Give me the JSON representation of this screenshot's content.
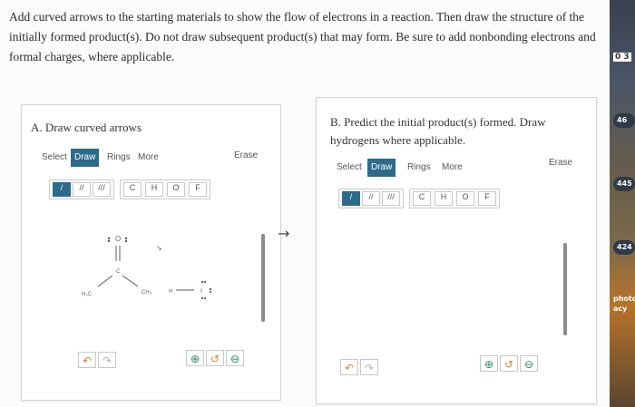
{
  "question": "Add curved arrows to the starting materials to show the flow of electrons in a reaction. Then draw the structure of the initially formed product(s). Do not draw subsequent product(s) that may form. Be sure to add nonbonding electrons and formal charges, where applicable.",
  "panel_a": {
    "title": "A. Draw curved arrows",
    "toolbar": [
      "Select",
      "Draw",
      "Rings",
      "More"
    ],
    "active_tool": "Draw",
    "erase": "Erase",
    "atoms": [
      "C",
      "H",
      "O",
      "F"
    ],
    "molecule": {
      "o_label": "O",
      "c_label": "C",
      "left_group": "H₃C",
      "right_group": "CH₃",
      "h_label": "H",
      "i_label": "I"
    }
  },
  "panel_b": {
    "title": "B. Predict the initial product(s) formed. Draw hydrogens where applicable.",
    "toolbar": [
      "Select",
      "Draw",
      "Rings",
      "More"
    ],
    "active_tool": "Draw",
    "erase": "Erase",
    "atoms": [
      "C",
      "H",
      "O",
      "F"
    ]
  },
  "reaction_arrow": "→",
  "side_labels": [
    "0 3",
    "46",
    "445",
    "424",
    "photo",
    "acy"
  ],
  "colors": {
    "accent": "#2d6b8a",
    "zoom": "#1f8a5a"
  }
}
